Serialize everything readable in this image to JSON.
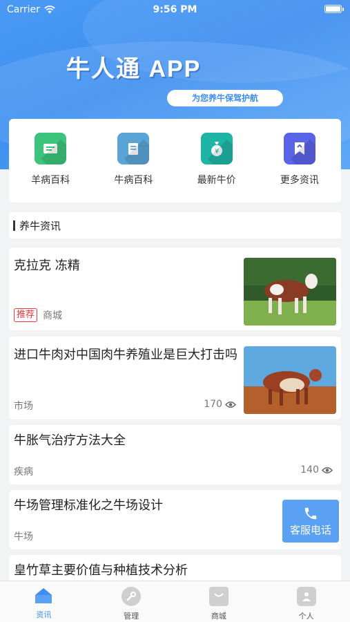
{
  "status_bar": {
    "carrier": "Carrier",
    "time": "9:56 PM"
  },
  "hero": {
    "title": "牛人通 APP",
    "subtitle": "为您养牛保驾护航"
  },
  "categories": [
    {
      "label": "羊病百科",
      "color": "#3cc47c",
      "icon": "card-icon"
    },
    {
      "label": "牛病百科",
      "color": "#5aa4d6",
      "icon": "book-icon"
    },
    {
      "label": "最新牛价",
      "color": "#1fb5a6",
      "icon": "money-bag-icon"
    },
    {
      "label": "更多资讯",
      "color": "#5a64e8",
      "icon": "bookmark-icon"
    }
  ],
  "section": {
    "title": "养牛资讯"
  },
  "news": [
    {
      "title": "克拉克 冻精",
      "tag": "推荐",
      "category": "商城",
      "views": ""
    },
    {
      "title": "进口牛肉对中国肉牛养殖业是巨大打击吗",
      "tag": "",
      "category": "市场",
      "views": "170"
    },
    {
      "title": "牛胀气治疗方法大全",
      "tag": "",
      "category": "疾病",
      "views": "140"
    },
    {
      "title": "牛场管理标准化之牛场设计",
      "tag": "",
      "category": "牛场",
      "views": ""
    },
    {
      "title": "皇竹草主要价值与种植技术分析",
      "tag": "",
      "category": "",
      "views": ""
    }
  ],
  "phone_button": {
    "label": "客服电话"
  },
  "tabbar": [
    {
      "label": "资讯",
      "icon": "home-icon",
      "active": true
    },
    {
      "label": "管理",
      "icon": "wrench-icon",
      "active": false
    },
    {
      "label": "商城",
      "icon": "shop-icon",
      "active": false
    },
    {
      "label": "个人",
      "icon": "user-icon",
      "active": false
    }
  ],
  "colors": {
    "primary": "#3d8ef0",
    "tag_red": "#e03a3a"
  }
}
